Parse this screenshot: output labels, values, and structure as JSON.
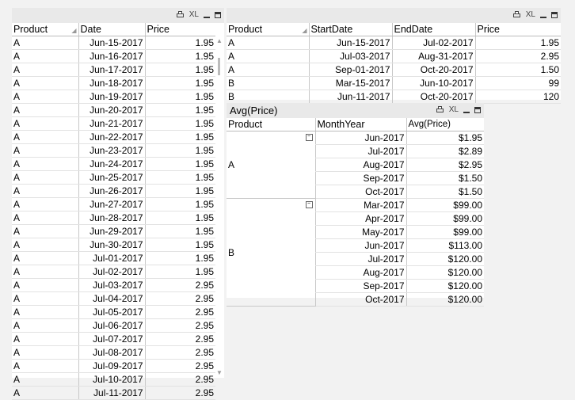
{
  "left_table": {
    "icons": [
      "print-icon",
      "xl-icon",
      "minimize-icon",
      "maximize-icon"
    ],
    "xl_label": "XL",
    "columns": [
      "Product",
      "Date",
      "Price"
    ],
    "rows": [
      [
        "A",
        "Jun-15-2017",
        "1.95"
      ],
      [
        "A",
        "Jun-16-2017",
        "1.95"
      ],
      [
        "A",
        "Jun-17-2017",
        "1.95"
      ],
      [
        "A",
        "Jun-18-2017",
        "1.95"
      ],
      [
        "A",
        "Jun-19-2017",
        "1.95"
      ],
      [
        "A",
        "Jun-20-2017",
        "1.95"
      ],
      [
        "A",
        "Jun-21-2017",
        "1.95"
      ],
      [
        "A",
        "Jun-22-2017",
        "1.95"
      ],
      [
        "A",
        "Jun-23-2017",
        "1.95"
      ],
      [
        "A",
        "Jun-24-2017",
        "1.95"
      ],
      [
        "A",
        "Jun-25-2017",
        "1.95"
      ],
      [
        "A",
        "Jun-26-2017",
        "1.95"
      ],
      [
        "A",
        "Jun-27-2017",
        "1.95"
      ],
      [
        "A",
        "Jun-28-2017",
        "1.95"
      ],
      [
        "A",
        "Jun-29-2017",
        "1.95"
      ],
      [
        "A",
        "Jun-30-2017",
        "1.95"
      ],
      [
        "A",
        "Jul-01-2017",
        "1.95"
      ],
      [
        "A",
        "Jul-02-2017",
        "1.95"
      ],
      [
        "A",
        "Jul-03-2017",
        "2.95"
      ],
      [
        "A",
        "Jul-04-2017",
        "2.95"
      ],
      [
        "A",
        "Jul-05-2017",
        "2.95"
      ],
      [
        "A",
        "Jul-06-2017",
        "2.95"
      ],
      [
        "A",
        "Jul-07-2017",
        "2.95"
      ],
      [
        "A",
        "Jul-08-2017",
        "2.95"
      ],
      [
        "A",
        "Jul-09-2017",
        "2.95"
      ],
      [
        "A",
        "Jul-10-2017",
        "2.95"
      ],
      [
        "A",
        "Jul-11-2017",
        "2.95"
      ]
    ]
  },
  "right_table": {
    "xl_label": "XL",
    "columns": [
      "Product",
      "StartDate",
      "EndDate",
      "Price"
    ],
    "rows": [
      [
        "A",
        "Jun-15-2017",
        "Jul-02-2017",
        "1.95"
      ],
      [
        "A",
        "Jul-03-2017",
        "Aug-31-2017",
        "2.95"
      ],
      [
        "A",
        "Sep-01-2017",
        "Oct-20-2017",
        "1.50"
      ],
      [
        "B",
        "Mar-15-2017",
        "Jun-10-2017",
        "99"
      ],
      [
        "B",
        "Jun-11-2017",
        "Oct-20-2017",
        "120"
      ]
    ]
  },
  "pivot": {
    "title": "Avg(Price)",
    "xl_label": "XL",
    "columns": [
      "Product",
      "MonthYear",
      "Avg(Price)"
    ],
    "collapse_symbol": "−",
    "groups": [
      {
        "product": "A",
        "rows": [
          [
            "Jun-2017",
            "$1.95"
          ],
          [
            "Jul-2017",
            "$2.89"
          ],
          [
            "Aug-2017",
            "$2.95"
          ],
          [
            "Sep-2017",
            "$1.50"
          ],
          [
            "Oct-2017",
            "$1.50"
          ]
        ]
      },
      {
        "product": "B",
        "rows": [
          [
            "Mar-2017",
            "$99.00"
          ],
          [
            "Apr-2017",
            "$99.00"
          ],
          [
            "May-2017",
            "$99.00"
          ],
          [
            "Jun-2017",
            "$113.00"
          ],
          [
            "Jul-2017",
            "$120.00"
          ],
          [
            "Aug-2017",
            "$120.00"
          ],
          [
            "Sep-2017",
            "$120.00"
          ],
          [
            "Oct-2017",
            "$120.00"
          ]
        ]
      }
    ]
  },
  "scrollbar": {
    "up": "▲",
    "down": "▼"
  }
}
